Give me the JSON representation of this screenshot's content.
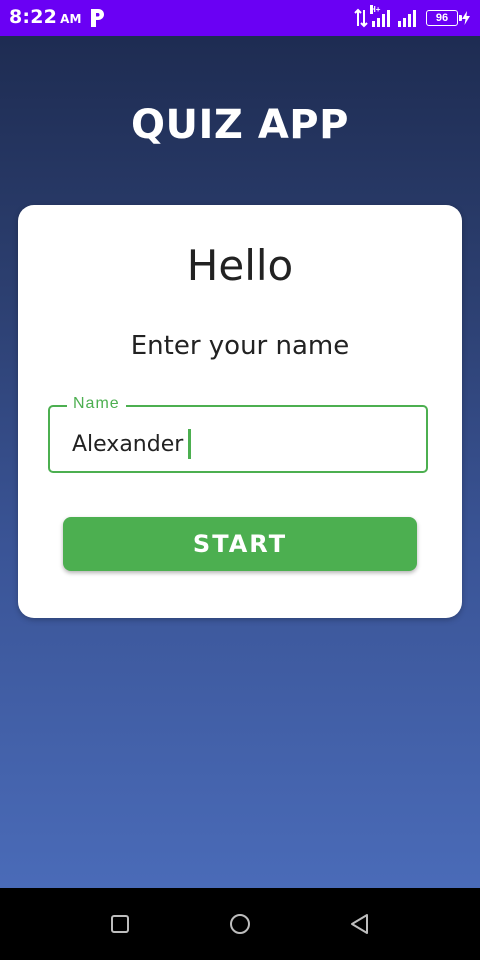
{
  "status_bar": {
    "time": "8:22",
    "ampm": "AM",
    "app_icon": "p-icon",
    "network": "H+",
    "battery": "96",
    "background": "#6a00f4"
  },
  "app": {
    "title": "QUIZ APP",
    "card": {
      "greeting": "Hello",
      "prompt": "Enter your name",
      "name_field": {
        "label": "Name",
        "value": "Alexander"
      },
      "start_label": "START"
    }
  },
  "nav_bar": {
    "buttons": [
      "recents-square-icon",
      "home-circle-icon",
      "back-triangle-icon"
    ]
  },
  "colors": {
    "accent": "#4caf50",
    "gradient_top": "#1e2c52",
    "gradient_bottom": "#4a6bb8"
  }
}
